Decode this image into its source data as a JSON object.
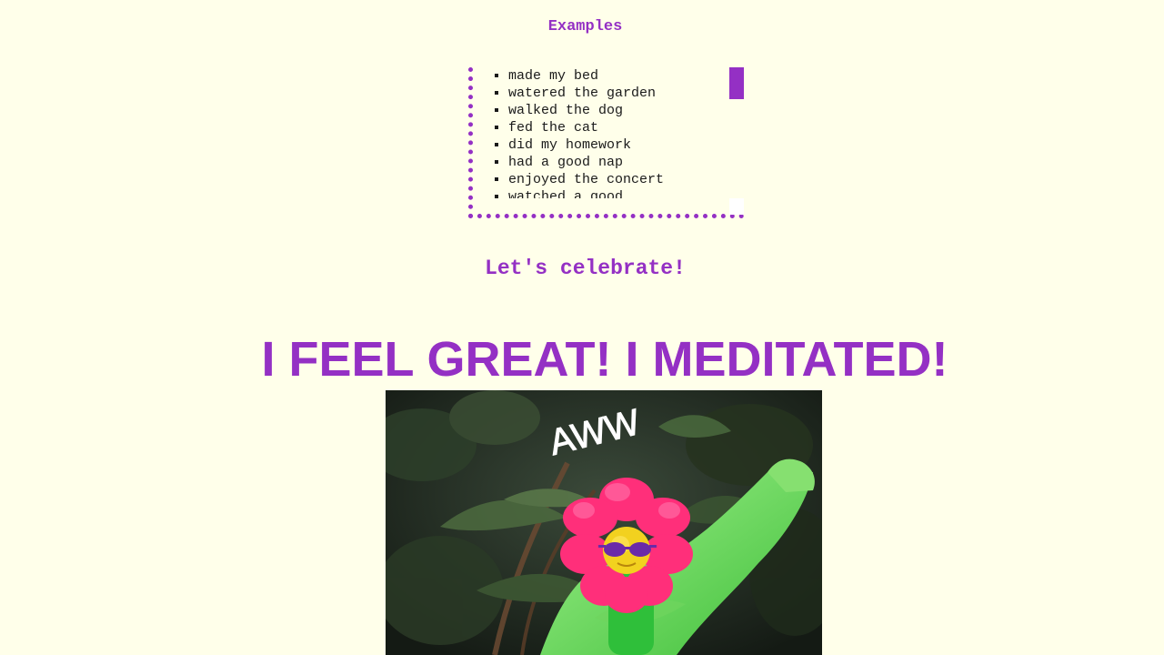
{
  "examples": {
    "title": "Examples",
    "items": [
      "made my bed",
      "watered the garden",
      "walked the dog",
      "fed the cat",
      "did my homework",
      "had a good nap",
      "enjoyed the concert",
      "watched a good"
    ],
    "scroll_position": 0
  },
  "celebrate_label": "Let's celebrate!",
  "headline": "I FEEL GREAT! I MEDITATED!",
  "gif": {
    "caption": "AWW"
  },
  "colors": {
    "accent": "#9430c4",
    "background": "#ffffea"
  }
}
